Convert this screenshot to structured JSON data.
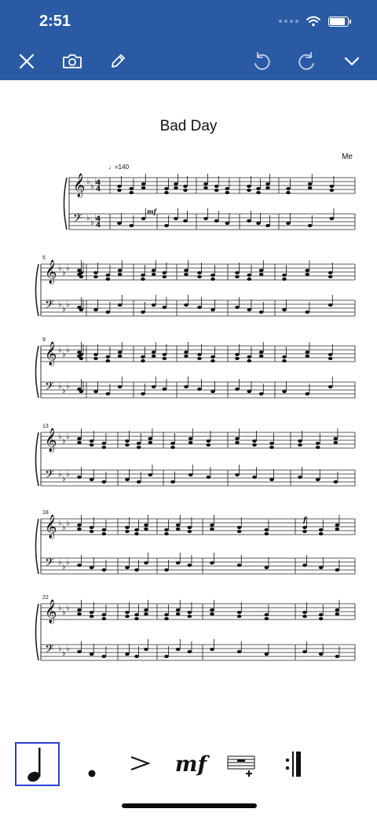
{
  "status_bar": {
    "time": "2:51"
  },
  "toolbar": {
    "icons": [
      "close-icon",
      "camera-icon",
      "pencil-icon",
      "undo-icon",
      "redo-icon",
      "chevron-down-icon"
    ]
  },
  "score": {
    "title": "Bad Day",
    "composer": "Me",
    "tempo": "♩=140",
    "measure_numbers": [
      "5",
      "9",
      "13",
      "18",
      "22"
    ],
    "dynamics": [
      "mf",
      "f"
    ]
  },
  "palette": {
    "items": [
      "quarter-note-icon",
      "dot-icon",
      "accent-icon",
      "dynamic-mf-icon",
      "insert-measure-icon",
      "repeat-icon"
    ],
    "dynamic_label": "mf",
    "selected": "quarter-note-icon"
  },
  "colors": {
    "toolbar_bg": "#2a5aa4",
    "selection": "#2b3fd9"
  }
}
